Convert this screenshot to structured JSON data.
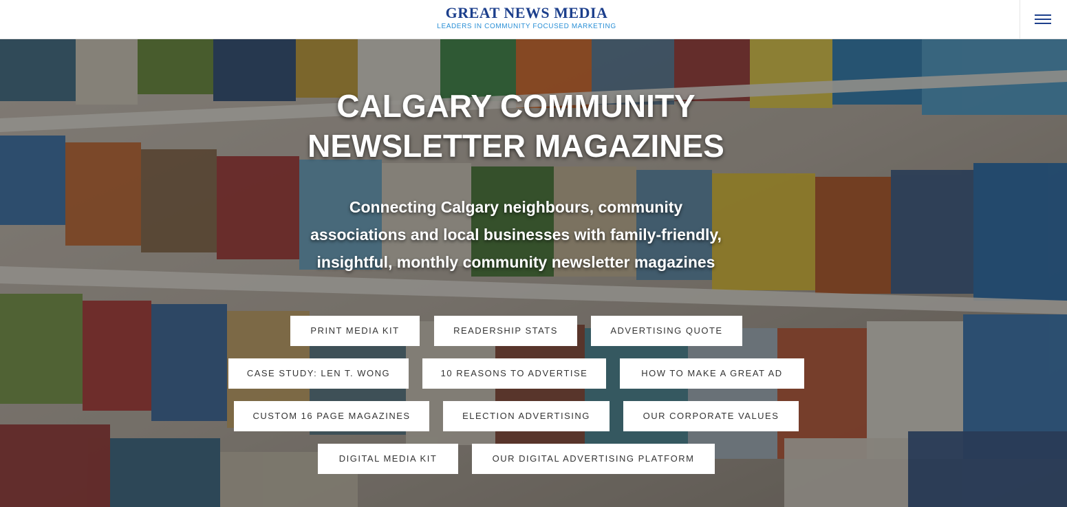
{
  "header": {
    "logo_title": "GREAT NEWS MEDIA",
    "logo_tagline": "LEADERS IN COMMUNITY FOCUSED MARKETING",
    "menu_icon": "hamburger-menu-icon"
  },
  "hero": {
    "title_line1": "CALGARY COMMUNITY",
    "title_line2": "NEWSLETTER MAGAZINES",
    "subtitle_line1": "Connecting Calgary neighbours, community",
    "subtitle_line2": "associations and local businesses with family-friendly,",
    "subtitle_line3": "insightful, monthly community newsletter magazines",
    "background": "magazine-rack-photo"
  },
  "buttons": {
    "print_media_kit": "PRINT MEDIA KIT",
    "readership_stats": "READERSHIP STATS",
    "advertising_quote": "ADVERTISING QUOTE",
    "case_study": "CASE STUDY: LEN T. WONG",
    "ten_reasons": "10 REASONS TO ADVERTISE",
    "great_ad": "HOW TO MAKE A GREAT AD",
    "custom_magazines": "CUSTOM 16 PAGE MAGAZINES",
    "election_advertising": "ELECTION ADVERTISING",
    "corporate_values": "OUR CORPORATE VALUES",
    "digital_media_kit": "DIGITAL MEDIA KIT",
    "digital_platform": "OUR DIGITAL ADVERTISING PLATFORM"
  },
  "colors": {
    "brand_navy": "#1c3f8c",
    "brand_blue": "#2a8fd6",
    "button_bg": "#ffffff",
    "button_text": "#333333"
  }
}
